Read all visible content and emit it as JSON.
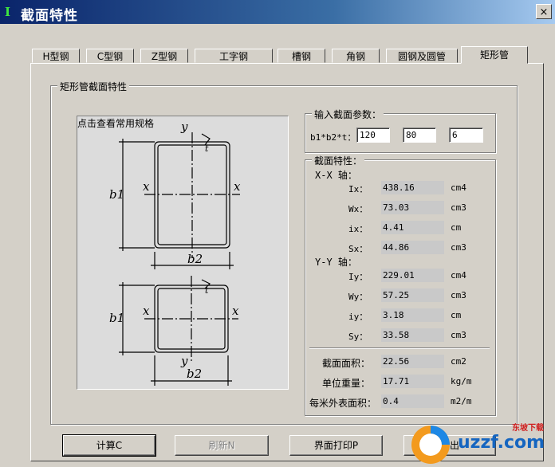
{
  "window": {
    "title": "截面特性",
    "close": "×"
  },
  "tabs": [
    "H型钢",
    "C型钢",
    "Z型钢",
    "工字钢",
    "槽钢",
    "角钢",
    "圆钢及圆管",
    "矩形管"
  ],
  "section_group": {
    "title": "矩形管截面特性",
    "diagram_link": "点击查看常用规格"
  },
  "diagram_labels": {
    "y": "y",
    "x": "x",
    "t": "t",
    "b1": "b1",
    "b2": "b2"
  },
  "input_group": {
    "title": "输入截面参数：",
    "label": "b1*b2*t：",
    "b1": "120",
    "b2": "80",
    "t": "6"
  },
  "props_group": {
    "title": "截面特性：",
    "xx_axis": "X-X 轴：",
    "yy_axis": "Y-Y 轴：",
    "rows": [
      {
        "label": "Ix：",
        "value": "438.16",
        "unit": "cm4"
      },
      {
        "label": "Wx：",
        "value": "73.03",
        "unit": "cm3"
      },
      {
        "label": "ix：",
        "value": "4.41",
        "unit": "cm"
      },
      {
        "label": "Sx：",
        "value": "44.86",
        "unit": "cm3"
      },
      {
        "label": "Iy：",
        "value": "229.01",
        "unit": "cm4"
      },
      {
        "label": "Wy：",
        "value": "57.25",
        "unit": "cm3"
      },
      {
        "label": "iy：",
        "value": "3.18",
        "unit": "cm"
      },
      {
        "label": "Sy：",
        "value": "33.58",
        "unit": "cm3"
      }
    ],
    "area": {
      "label": "截面面积：",
      "value": "22.56",
      "unit": "cm2"
    },
    "weight": {
      "label": "单位重量：",
      "value": "17.71",
      "unit": "kg/m"
    },
    "surface": {
      "label": "每米外表面积：",
      "value": "0.4",
      "unit": "m2/m"
    }
  },
  "buttons": {
    "calc": "计算C",
    "refresh": "刷新N",
    "print": "界面打印P",
    "exit": "退出"
  },
  "watermark": {
    "brand": "uzzf.com",
    "small": "东坡下载"
  }
}
